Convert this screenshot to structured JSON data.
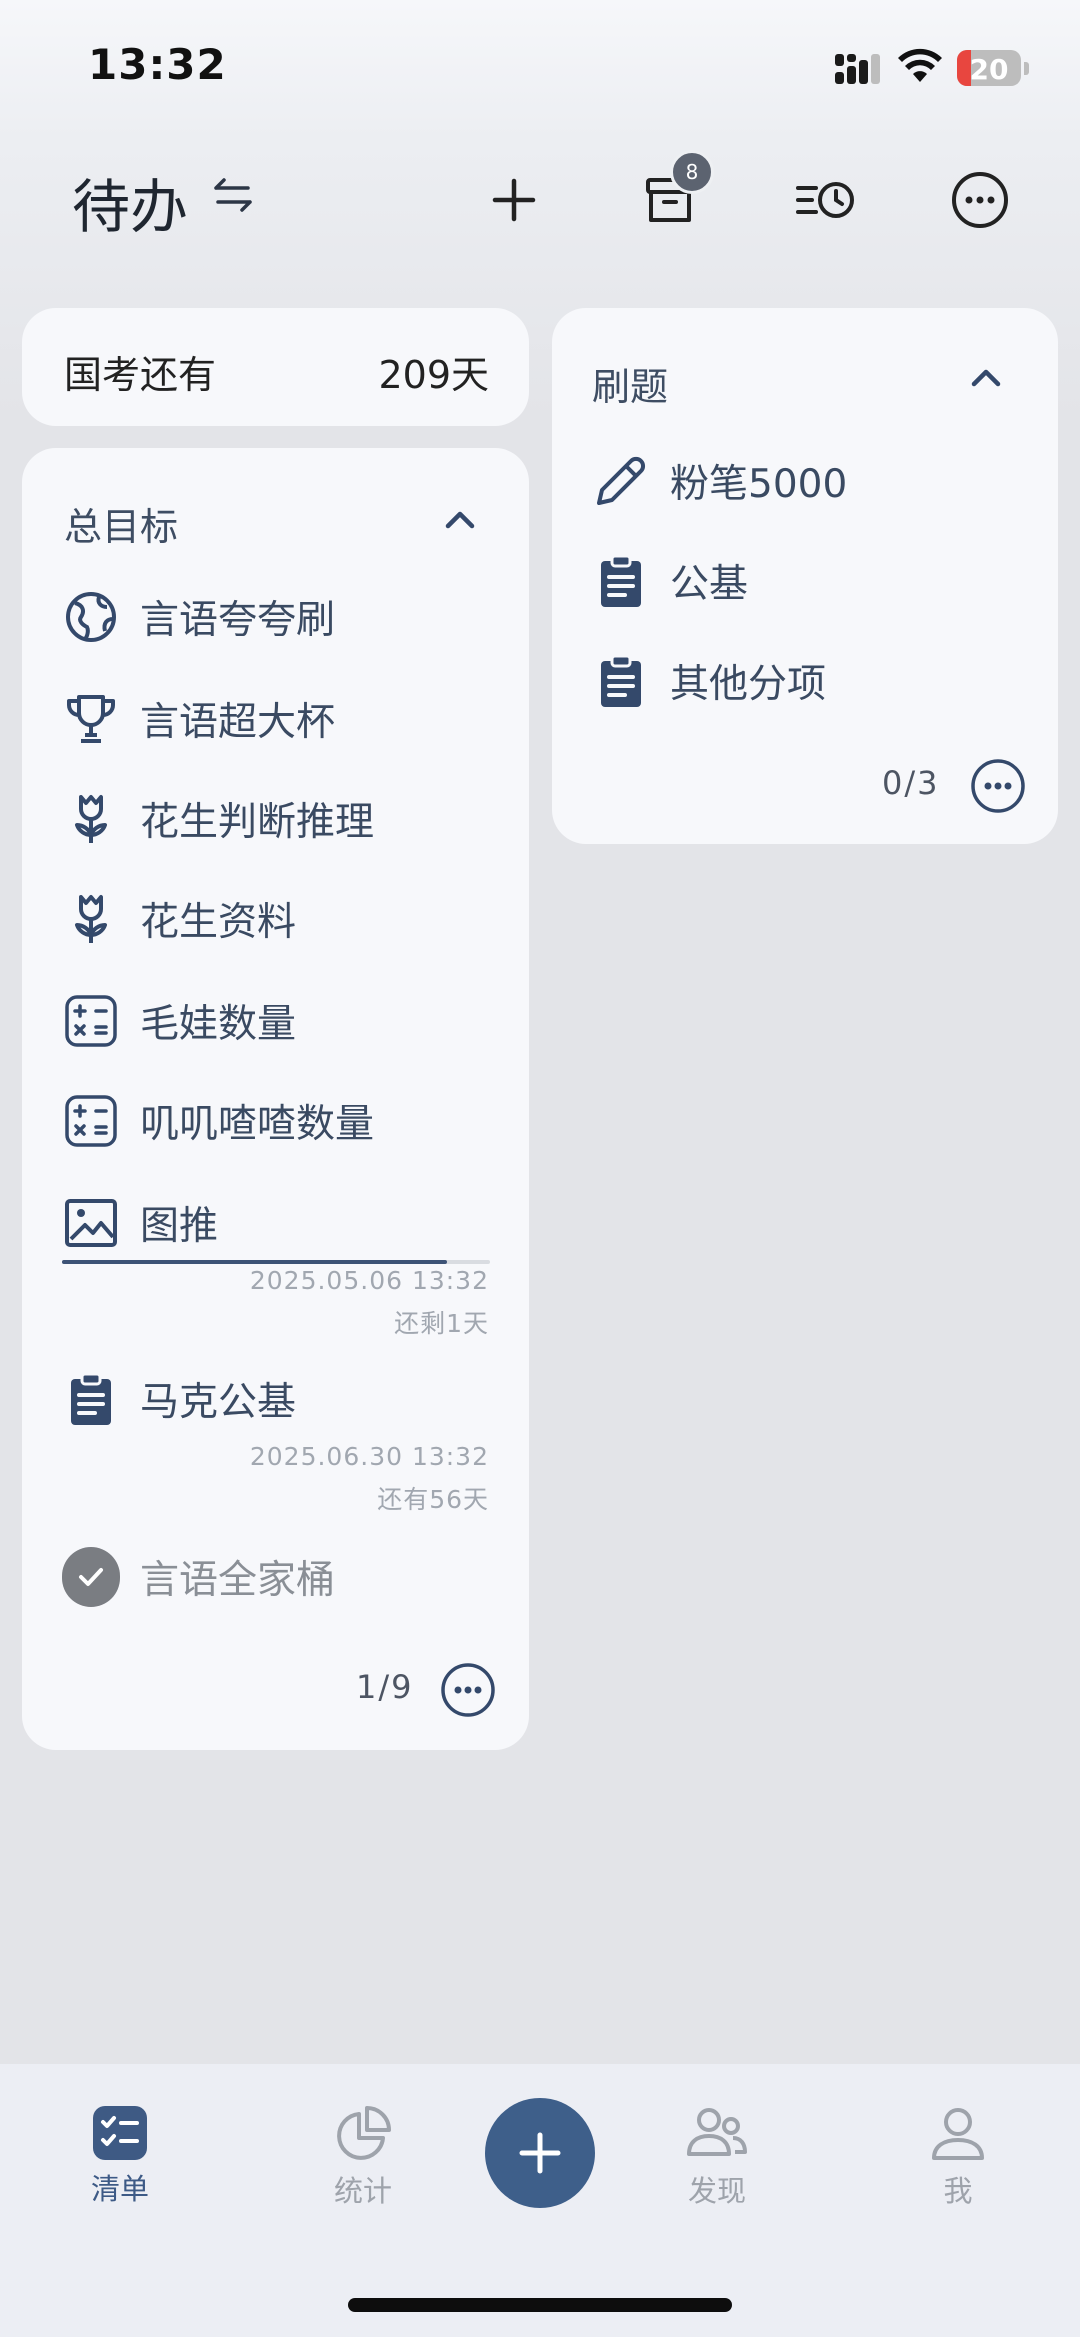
{
  "status_bar": {
    "time": "13:32",
    "battery": "20",
    "battery_color": "#e8463f"
  },
  "header": {
    "title": "待办",
    "archive_badge": "8"
  },
  "countdown": {
    "label": "国考还有",
    "value": "209天"
  },
  "goals": {
    "title": "总目标",
    "items": [
      {
        "label": "言语夸夸刷",
        "icon": "globe-icon"
      },
      {
        "label": "言语超大杯",
        "icon": "trophy-icon"
      },
      {
        "label": "花生判断推理",
        "icon": "tulip-icon"
      },
      {
        "label": "花生资料",
        "icon": "tulip-icon"
      },
      {
        "label": "毛娃数量",
        "icon": "calculator-icon"
      },
      {
        "label": "叽叽喳喳数量",
        "icon": "calculator-icon"
      },
      {
        "label": "图推",
        "icon": "image-icon",
        "date": "2025.05.06 13:32",
        "remaining": "还剩1天",
        "progress": 0.9
      },
      {
        "label": "马克公基",
        "icon": "clipboard-icon",
        "date": "2025.06.30 13:32",
        "remaining": "还有56天"
      },
      {
        "label": "言语全家桶",
        "icon": "check-circle-icon",
        "completed": true
      }
    ],
    "count": "1/9"
  },
  "practice": {
    "title": "刷题",
    "items": [
      {
        "label": "粉笔5000",
        "icon": "pencil-icon"
      },
      {
        "label": "公基",
        "icon": "clipboard-icon"
      },
      {
        "label": "其他分项",
        "icon": "clipboard-icon"
      }
    ],
    "count": "0/3"
  },
  "nav": {
    "items": [
      {
        "label": "清单",
        "icon": "checklist-icon",
        "active": true
      },
      {
        "label": "统计",
        "icon": "pie-chart-icon"
      },
      {
        "label": "发现",
        "icon": "users-icon"
      },
      {
        "label": "我",
        "icon": "person-icon"
      }
    ]
  },
  "colors": {
    "accent": "#3e5f8a",
    "icon": "#34496b",
    "card": "#f7f8fb"
  }
}
